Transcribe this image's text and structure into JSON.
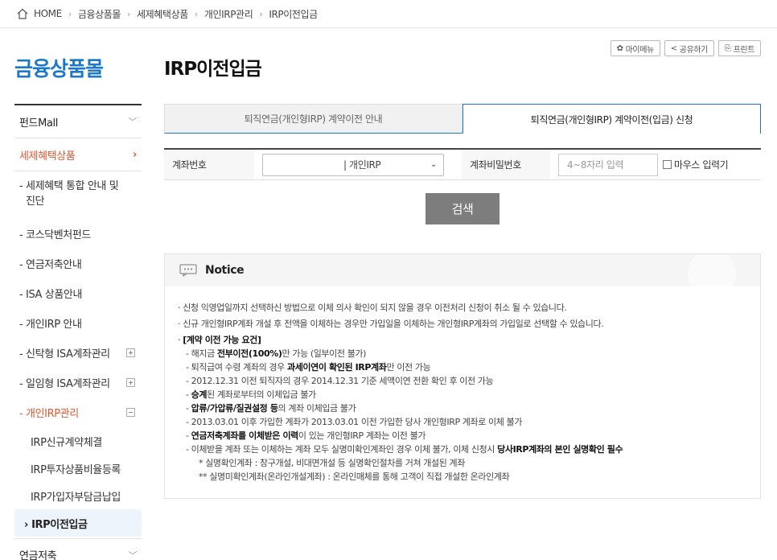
{
  "breadcrumb": [
    "HOME",
    "금융상품몰",
    "세제혜택상품",
    "개인IRP관리",
    "IRP이전입금"
  ],
  "sidebar": {
    "title": "금융상품몰",
    "items": [
      {
        "label": "펀드Mall"
      },
      {
        "label": "세제혜택상품"
      }
    ],
    "subs": [
      "- 세제혜택 통합 안내 및",
      "진단",
      "- 코스닥벤처펀드",
      "- 연금저축안내",
      "- ISA 상품안내",
      "- 개인IRP 안내",
      "- 신탁형 ISA계좌관리",
      "- 일임형 ISA계좌관리",
      "- 개인IRP관리"
    ],
    "sub3": [
      "IRP신규계약체결",
      "IRP투자상품비율등록",
      "IRP가입자부담금납입",
      "› IRP이전입금"
    ],
    "last": "연금저축"
  },
  "page": {
    "title": "IRP이전입금",
    "tools": [
      "마이메뉴",
      "공유하기",
      "프린트"
    ],
    "tabs": [
      "퇴직연금(개인형IRP) 계약이전 안내",
      "퇴직연금(개인형IRP) 계약이전(입금) 신청"
    ]
  },
  "form": {
    "account_label": "계좌번호",
    "account_value": "| 개인IRP",
    "pw_label": "계좌비밀번호",
    "pw_placeholder": "4~8자리 입력",
    "mouse_label": "마우스 입력기",
    "search": "검색"
  },
  "notice": {
    "title": "Notice",
    "l1": "· 신청 익영업일까지 선택하신 방법으로 이체 의사 확인이 되지 않을 경우 이전처리 신청이 취소 될 수 있습니다.",
    "l2": "· 신규 개인형IRP계좌 개설 후 전액을 이체하는 경우만 가입일을 이체하는 개인형IRP계좌의 가입일로 선택할 수 있습니다.",
    "l3": "[계약 이전 가능 요건]",
    "s1a": "- 해지금 ",
    "s1b": "전부이전(100%)",
    "s1c": "만 가능 (일부이전 불가)",
    "s2a": "- 퇴직급여 수령 계좌의 경우 ",
    "s2b": "과세이연이 확인된 IRP계좌",
    "s2c": "만 이전 가능",
    "s3": "- 2012.12.31 이전 퇴직자의 경우 2014.12.31 기준 세액이연 전환 확인 후 이전 가능",
    "s4a": "- ",
    "s4b": "승계",
    "s4c": "된 계좌로부터의 이체입금 불가",
    "s5a": "- ",
    "s5b": "압류/가압류/질권설정 등",
    "s5c": "의 계좌 이체입금 불가",
    "s6": "- 2013.03.01 이후 가입한 계좌가 2013.03.01 이전 가입한 당사 개인형IRP 계좌로 이체 불가",
    "s7a": "- ",
    "s7b": "연금저축계좌를 이체받은 이력",
    "s7c": "이 있는 개인형IRP 계좌는 이전 불가",
    "s8a": "- 이체받을 계좌 또는 이체하는 계좌 모두 실명미확인계좌인 경우 이체 불가, 이체 신청시 ",
    "s8b": "당사IRP계좌의 본인 실명확인 필수",
    "st1": "*  실명확인계좌 : 창구개설, 비대면개설 등 실명확인절차를 거쳐 개설된 계좌",
    "st2": "** 실명미확인계좌(온라인개설계좌) : 온라인매체를 통해 고객이 직접 개설한 온라인계좌"
  }
}
